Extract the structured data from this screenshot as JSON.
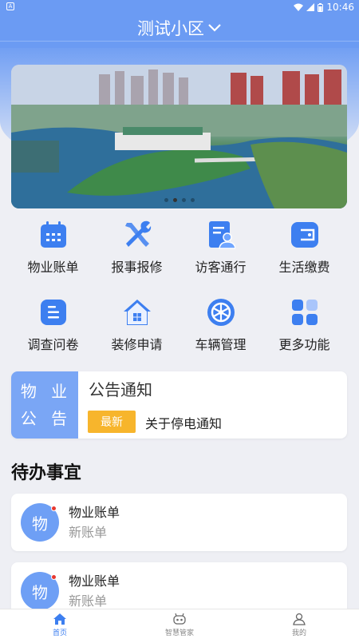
{
  "statusbar": {
    "left_icon": "A",
    "time": "10:46"
  },
  "header": {
    "community_name": "测试小区"
  },
  "banner": {
    "slides": 4,
    "active_slide": 2
  },
  "services": [
    {
      "label": "物业账单",
      "icon": "calendar-icon"
    },
    {
      "label": "报事报修",
      "icon": "tools-icon"
    },
    {
      "label": "访客通行",
      "icon": "visitor-icon"
    },
    {
      "label": "生活缴费",
      "icon": "wallet-icon"
    },
    {
      "label": "调查问卷",
      "icon": "survey-icon"
    },
    {
      "label": "装修申请",
      "icon": "house-icon"
    },
    {
      "label": "车辆管理",
      "icon": "wheel-icon"
    },
    {
      "label": "更多功能",
      "icon": "grid-icon"
    }
  ],
  "notice": {
    "tag_line1": "物 业",
    "tag_line2": "公 告",
    "title": "公告通知",
    "badge": "最新",
    "text": "关于停电通知"
  },
  "todo": {
    "title": "待办事宜",
    "items": [
      {
        "avatar": "物",
        "title": "物业账单",
        "subtitle": "新账单"
      },
      {
        "avatar": "物",
        "title": "物业账单",
        "subtitle": "新账单"
      }
    ]
  },
  "tabbar": {
    "tabs": [
      {
        "label": "首页",
        "icon": "home-icon",
        "active": true
      },
      {
        "label": "智慧管家",
        "icon": "robot-icon",
        "active": false
      },
      {
        "label": "我的",
        "icon": "user-icon",
        "active": false
      }
    ]
  },
  "colors": {
    "primary": "#6b9bf3",
    "accent": "#3d7ff0",
    "badge": "#f7b52c",
    "notification": "#e8382f"
  }
}
